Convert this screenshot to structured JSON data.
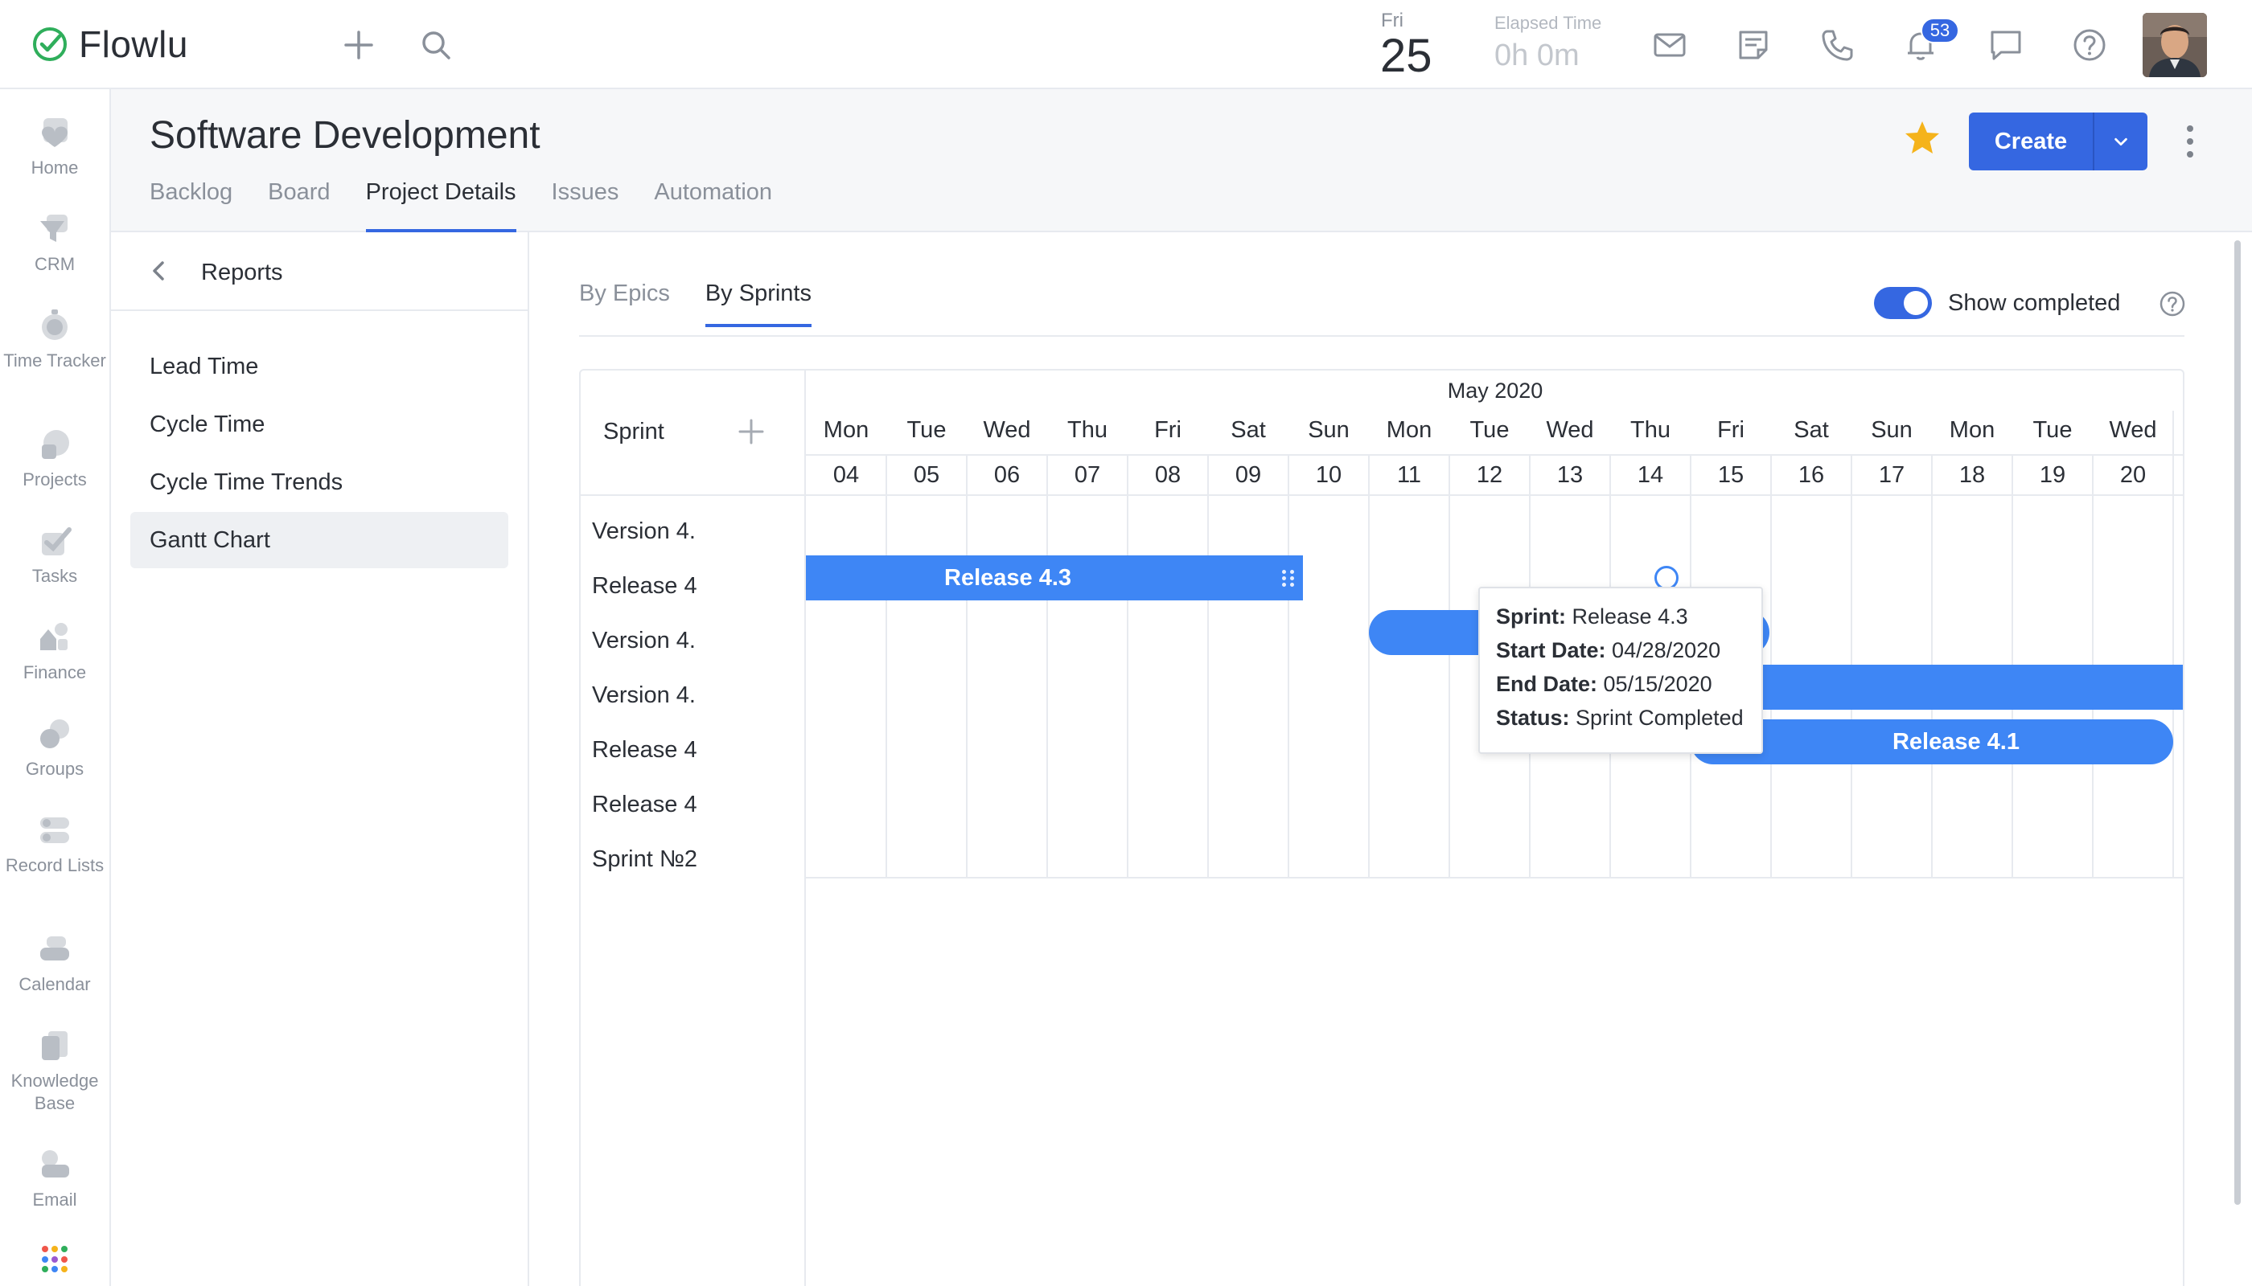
{
  "brand": {
    "name": "Flowlu"
  },
  "topbar": {
    "date_day": "Fri",
    "date_num": "25",
    "elapsed_label": "Elapsed Time",
    "elapsed_value": "0h 0m",
    "notifications_count": "53"
  },
  "appnav": {
    "items": [
      {
        "label": "Home",
        "icon": "home-icon"
      },
      {
        "label": "CRM",
        "icon": "crm-icon"
      },
      {
        "label": "Time Tracker",
        "icon": "time-tracker-icon"
      },
      {
        "label": "Projects",
        "icon": "projects-icon"
      },
      {
        "label": "Tasks",
        "icon": "tasks-icon"
      },
      {
        "label": "Finance",
        "icon": "finance-icon"
      },
      {
        "label": "Groups",
        "icon": "groups-icon"
      },
      {
        "label": "Record Lists",
        "icon": "record-lists-icon"
      },
      {
        "label": "Calendar",
        "icon": "calendar-icon"
      },
      {
        "label": "Knowledge Base",
        "icon": "knowledge-base-icon"
      },
      {
        "label": "Email",
        "icon": "email-icon"
      }
    ]
  },
  "page": {
    "title": "Software Development",
    "tabs": [
      "Backlog",
      "Board",
      "Project Details",
      "Issues",
      "Automation"
    ],
    "active_tab": "Project Details",
    "create_label": "Create"
  },
  "reports": {
    "title": "Reports",
    "items": [
      "Lead Time",
      "Cycle Time",
      "Cycle Time Trends",
      "Gantt Chart"
    ],
    "active": "Gantt Chart"
  },
  "main": {
    "tabs": [
      "By Epics",
      "By Sprints"
    ],
    "active_tab": "By Sprints",
    "show_completed_label": "Show completed",
    "show_completed": true
  },
  "gantt": {
    "sprint_header": "Sprint",
    "month": "May 2020",
    "days": [
      {
        "name": "Mon",
        "num": "04"
      },
      {
        "name": "Tue",
        "num": "05"
      },
      {
        "name": "Wed",
        "num": "06"
      },
      {
        "name": "Thu",
        "num": "07"
      },
      {
        "name": "Fri",
        "num": "08"
      },
      {
        "name": "Sat",
        "num": "09"
      },
      {
        "name": "Sun",
        "num": "10"
      },
      {
        "name": "Mon",
        "num": "11"
      },
      {
        "name": "Tue",
        "num": "12"
      },
      {
        "name": "Wed",
        "num": "13"
      },
      {
        "name": "Thu",
        "num": "14"
      },
      {
        "name": "Fri",
        "num": "15"
      },
      {
        "name": "Sat",
        "num": "16"
      },
      {
        "name": "Sun",
        "num": "17"
      },
      {
        "name": "Mon",
        "num": "18"
      },
      {
        "name": "Tue",
        "num": "19"
      },
      {
        "name": "Wed",
        "num": "20"
      }
    ],
    "rows": [
      "Version 4.",
      "Release 4",
      "Version 4.",
      "Version 4.",
      "Release 4",
      "Release 4",
      "Sprint №2"
    ],
    "bars": [
      {
        "label": "Release 4.3"
      },
      {
        "label": ""
      },
      {
        "label": ""
      },
      {
        "label": "Release 4.1"
      }
    ]
  },
  "tooltip": {
    "sprint_key": "Sprint:",
    "sprint_val": "Release 4.3",
    "start_key": "Start Date:",
    "start_val": "04/28/2020",
    "end_key": "End Date:",
    "end_val": "05/15/2020",
    "status_key": "Status:",
    "status_val": "Sprint Completed"
  },
  "colors": {
    "accent": "#3567e1",
    "bar": "#3e86f5",
    "brand_green": "#2fae5b",
    "star": "#f5b31b"
  }
}
